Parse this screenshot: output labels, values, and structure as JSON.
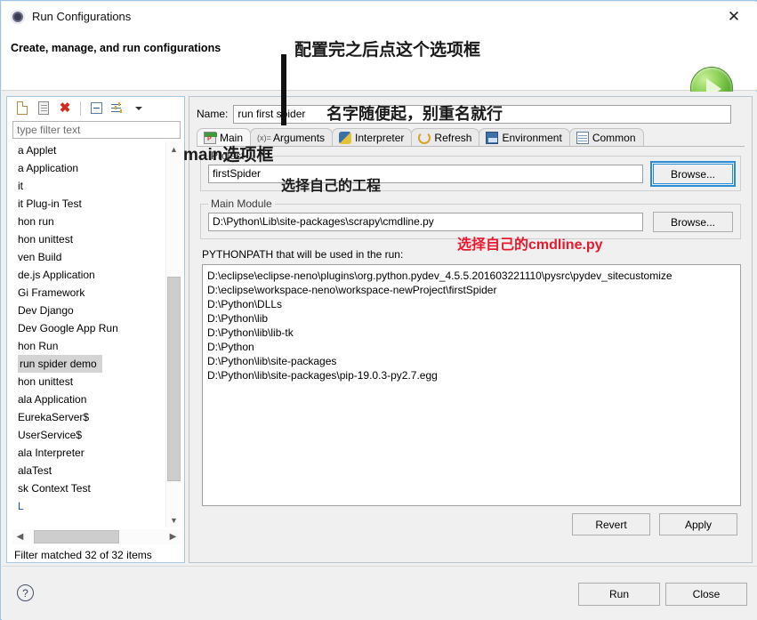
{
  "window": {
    "title": "Run Configurations",
    "close_label": "✕",
    "header_title": "Create, manage, and run configurations"
  },
  "toolbar": {
    "new_label": "new-configuration",
    "duplicate_label": "duplicate-configuration",
    "delete_label": "✖",
    "collapse_label": "collapse-all",
    "filter_label": "filter",
    "menu_label": "▾"
  },
  "filter": {
    "placeholder": "type filter text",
    "value": "type filter text",
    "status": "Filter matched 32 of 32 items"
  },
  "tree": {
    "items": [
      {
        "label": "a Applet",
        "selected": false
      },
      {
        "label": "a Application",
        "selected": false
      },
      {
        "label": "it",
        "selected": false
      },
      {
        "label": "it Plug-in Test",
        "selected": false
      },
      {
        "label": "hon run",
        "selected": false
      },
      {
        "label": "hon unittest",
        "selected": false
      },
      {
        "label": "ven Build",
        "selected": false
      },
      {
        "label": "de.js Application",
        "selected": false
      },
      {
        "label": "Gi Framework",
        "selected": false
      },
      {
        "label": "Dev Django",
        "selected": false
      },
      {
        "label": "Dev Google App Run",
        "selected": false
      },
      {
        "label": "hon Run",
        "selected": false
      },
      {
        "label": "run spider demo",
        "selected": true
      },
      {
        "label": "hon unittest",
        "selected": false
      },
      {
        "label": "ala Application",
        "selected": false
      },
      {
        "label": "EurekaServer$",
        "selected": false
      },
      {
        "label": "UserService$",
        "selected": false
      },
      {
        "label": "ala Interpreter",
        "selected": false
      },
      {
        "label": "alaTest",
        "selected": false
      },
      {
        "label": "sk Context Test",
        "selected": false
      },
      {
        "label": "L",
        "selected": false
      }
    ]
  },
  "config": {
    "name_label": "Name:",
    "name_value": "run first spider",
    "tabs": [
      {
        "label": "Main",
        "icon": "main-tab-icon",
        "active": true
      },
      {
        "label": "Arguments",
        "icon": "arguments-tab-icon",
        "active": false
      },
      {
        "label": "Interpreter",
        "icon": "interpreter-tab-icon",
        "active": false
      },
      {
        "label": "Refresh",
        "icon": "refresh-tab-icon",
        "active": false
      },
      {
        "label": "Environment",
        "icon": "environment-tab-icon",
        "active": false
      },
      {
        "label": "Common",
        "icon": "common-tab-icon",
        "active": false
      }
    ],
    "project_group_title": "Project",
    "project_value": "firstSpider",
    "project_browse_label": "Browse...",
    "module_group_title": "Main Module",
    "module_value": "D:\\Python\\Lib\\site-packages\\scrapy\\cmdline.py",
    "module_browse_label": "Browse...",
    "pythonpath_label": "PYTHONPATH that will be used in the run:",
    "pythonpath_entries": [
      "D:\\eclipse\\eclipse-neno\\plugins\\org.python.pydev_4.5.5.201603221110\\pysrc\\pydev_sitecustomize",
      "D:\\eclipse\\workspace-neno\\workspace-newProject\\firstSpider",
      "D:\\Python\\DLLs",
      "D:\\Python\\lib",
      "D:\\Python\\lib\\lib-tk",
      "D:\\Python",
      "D:\\Python\\lib\\site-packages",
      "D:\\Python\\lib\\site-packages\\pip-19.0.3-py2.7.egg"
    ],
    "revert_label": "Revert",
    "apply_label": "Apply"
  },
  "footer": {
    "help_label": "?",
    "run_label": "Run",
    "close_label": "Close"
  },
  "annotations": {
    "top_note": "配置完之后点这个选项框",
    "name_note": "名字随便起，别重名就行",
    "main_tab_note": "main选项框",
    "project_note": "选择自己的工程",
    "module_note": "选择自己的cmdline.py"
  },
  "colors": {
    "annotation_red": "#e8192c",
    "annotation_black": "#1a1a1a",
    "focus_blue": "#2a8bd6",
    "run_green": "#4fa32a",
    "selection_gray": "#d4d4d4"
  }
}
